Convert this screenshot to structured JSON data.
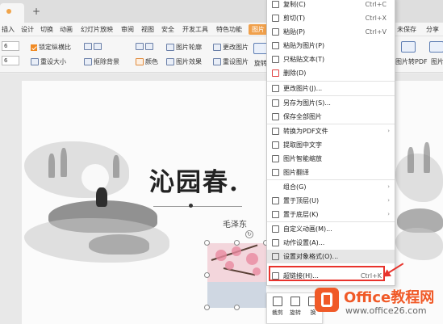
{
  "tabbar": {
    "new_tab": "+"
  },
  "ribbon_tabs": [
    "插入",
    "设计",
    "切换",
    "动画",
    "幻灯片放映",
    "审阅",
    "视图",
    "安全",
    "开发工具",
    "特色功能",
    "图片"
  ],
  "ribbon_right": {
    "unsaved": "未保存",
    "share": "分享"
  },
  "toolbar": {
    "width_value": "6",
    "height_value": "6",
    "lock_ratio": "锁定纵横比",
    "reset_size": "重设大小",
    "remove_bg": "抠除背景",
    "color": "颜色",
    "picture_outline": "图片轮廓",
    "picture_effect": "图片效果",
    "change_picture": "更改图片",
    "reset_picture": "重设图片",
    "rotate": "旋转",
    "pic_to_pdf": "图片转PDF",
    "pic_to_text": "图片"
  },
  "context_menu": {
    "items": [
      {
        "label": "复制(C)",
        "shortcut": "Ctrl+C",
        "icon": "copy-icon"
      },
      {
        "label": "剪切(T)",
        "shortcut": "Ctrl+X",
        "icon": "cut-icon"
      },
      {
        "label": "粘贴(P)",
        "shortcut": "Ctrl+V",
        "icon": "paste-icon"
      },
      {
        "label": "粘贴为图片(P)",
        "shortcut": "",
        "icon": "paste-picture-icon"
      },
      {
        "label": "只粘贴文本(T)",
        "shortcut": "",
        "icon": "paste-text-icon"
      },
      {
        "label": "删除(D)",
        "shortcut": "",
        "icon": "delete-icon"
      },
      {
        "label": "更改图片(J)...",
        "shortcut": "",
        "icon": "change-picture-icon"
      },
      {
        "label": "另存为图片(S)...",
        "shortcut": "",
        "icon": "save-picture-icon"
      },
      {
        "label": "保存全部图片",
        "shortcut": "",
        "icon": "save-all-icon"
      },
      {
        "label": "转换为PDF文件",
        "shortcut": "",
        "icon": "pdf-icon"
      },
      {
        "label": "提取图中文字",
        "shortcut": "",
        "icon": "extract-text-icon"
      },
      {
        "label": "图片智能缩放",
        "shortcut": "",
        "icon": "smart-scale-icon"
      },
      {
        "label": "图片翻译",
        "shortcut": "",
        "icon": "translate-icon"
      },
      {
        "label": "组合(G)",
        "shortcut": "",
        "icon": "group-icon"
      },
      {
        "label": "置于顶层(U)",
        "shortcut": "",
        "icon": "bring-front-icon"
      },
      {
        "label": "置于底层(K)",
        "shortcut": "",
        "icon": "send-back-icon"
      },
      {
        "label": "自定义动画(M)...",
        "shortcut": "",
        "icon": "animation-icon"
      },
      {
        "label": "动作设置(A)...",
        "shortcut": "",
        "icon": "action-icon"
      },
      {
        "label": "设置对象格式(O)...",
        "shortcut": "",
        "icon": "format-icon"
      },
      {
        "label": "超链接(H)...",
        "shortcut": "Ctrl+K",
        "icon": "hyperlink-icon"
      }
    ]
  },
  "slide": {
    "title": "沁园春.",
    "author": "毛泽东"
  },
  "mini_toolbar": {
    "crop": "裁剪",
    "rotate": "旋转",
    "more": "换"
  },
  "watermark": {
    "title": "Office教程网",
    "url": "www.office26.com"
  },
  "colors": {
    "accent": "#f0a04b",
    "highlight_red": "#e8332c",
    "watermark_orange": "#f05a28"
  }
}
